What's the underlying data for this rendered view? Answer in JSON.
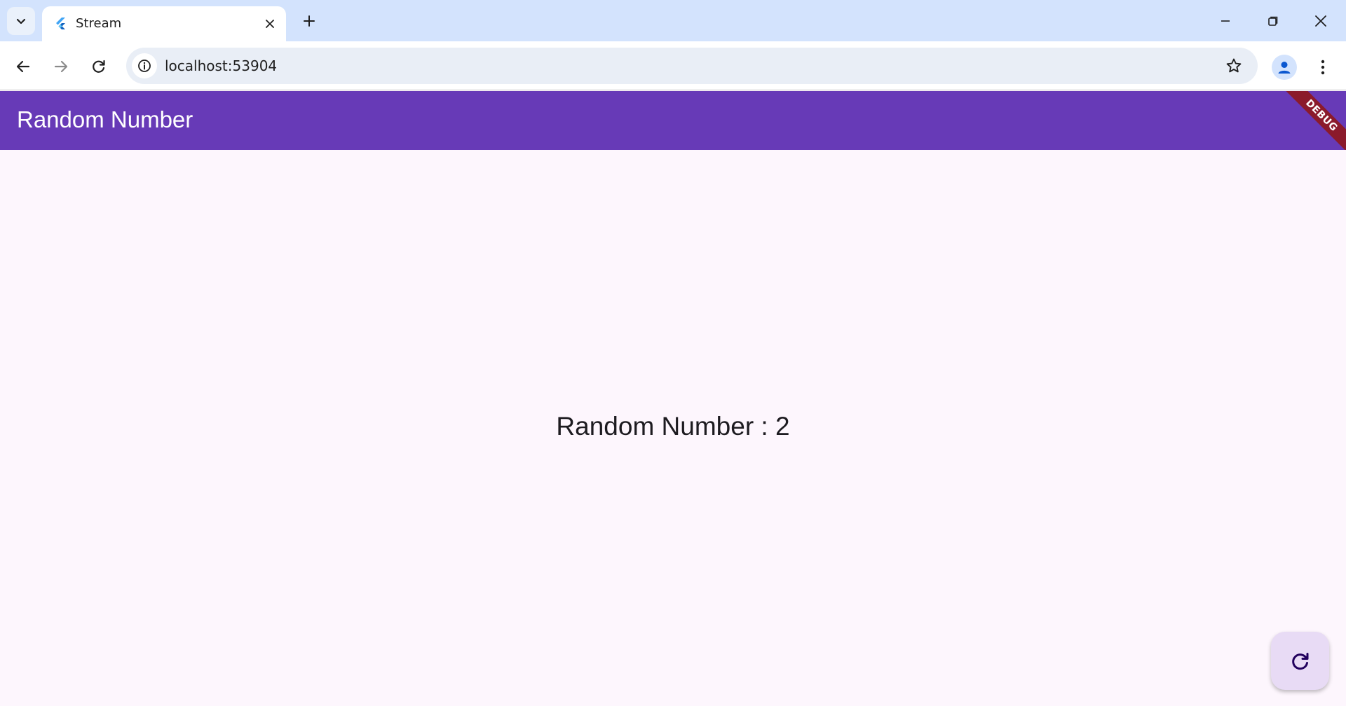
{
  "browser": {
    "tab": {
      "title": "Stream"
    },
    "url": "localhost:53904"
  },
  "app": {
    "title": "Random Number",
    "debug_banner": "DEBUG",
    "random_text": "Random Number : 2"
  },
  "colors": {
    "appbar": "#673ab7",
    "background": "#fdf6fd",
    "fab": "#e8dbf5",
    "debug_banner": "#8b1a2b"
  }
}
